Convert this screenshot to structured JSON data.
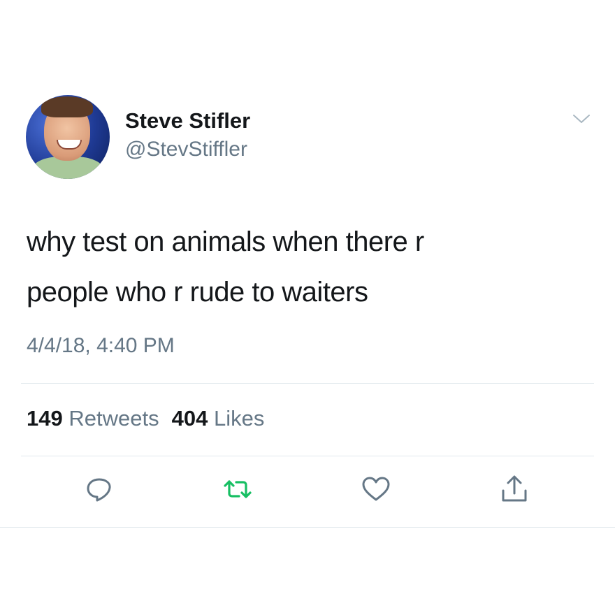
{
  "author": {
    "name": "Steve Stifler",
    "handle": "@StevStiffler"
  },
  "tweet": {
    "lines": [
      "why test on animals when there r",
      "people who r rude to waiters"
    ],
    "timestamp": "4/4/18, 4:40 PM"
  },
  "stats": {
    "retweets_count": "149",
    "retweets_label": "Retweets",
    "likes_count": "404",
    "likes_label": "Likes"
  },
  "icons": {
    "reply": "reply-icon",
    "retweet": "retweet-icon",
    "like": "heart-icon",
    "share": "share-icon",
    "menu": "chevron-down-icon"
  },
  "colors": {
    "text": "#14171a",
    "secondary": "#657786",
    "retweet_green": "#17bf63",
    "divider": "#e1e8ed"
  }
}
